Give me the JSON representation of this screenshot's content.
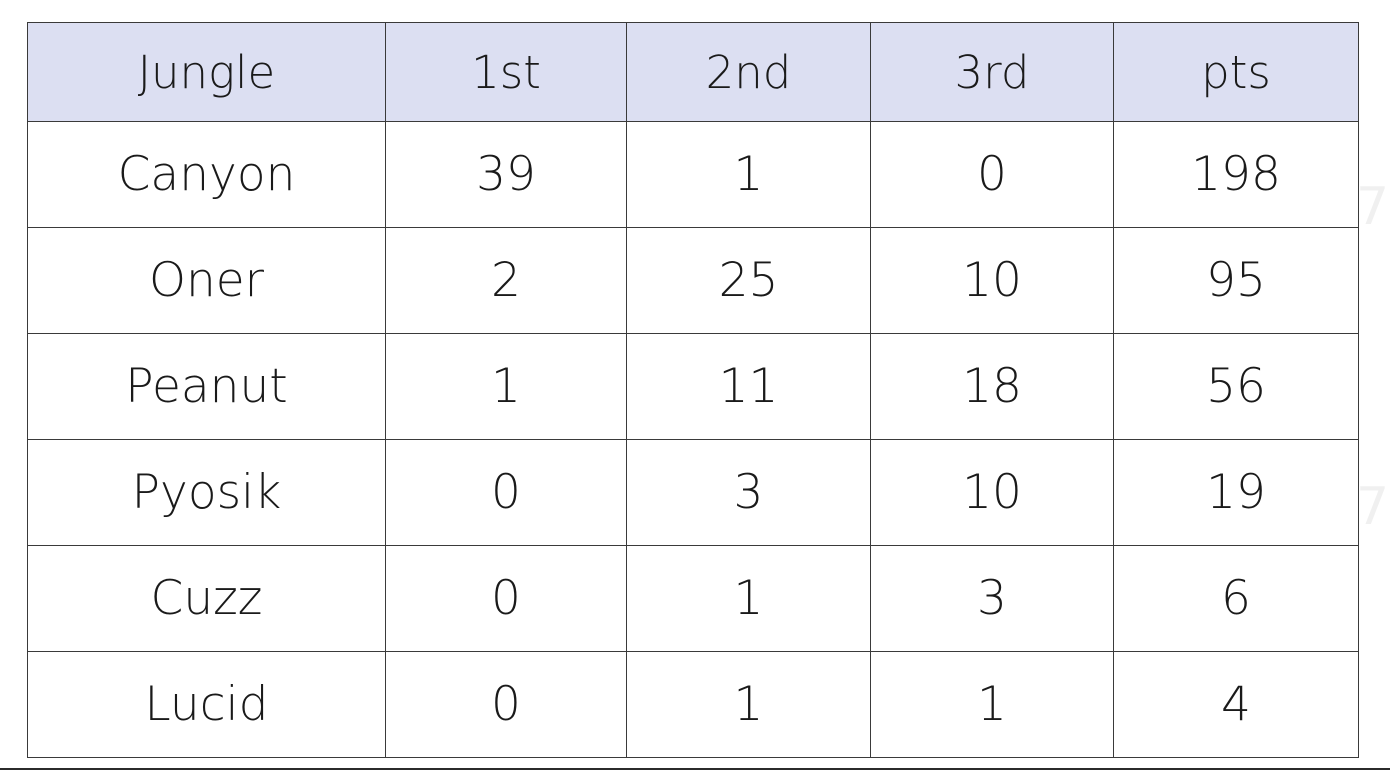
{
  "table": {
    "name": "jungle-standings",
    "columns": [
      "Jungle",
      "1st",
      "2nd",
      "3rd",
      "pts"
    ],
    "header_background": "#dcdff2",
    "border_color": "#3a3a3a",
    "text_color": "#1a1a1a",
    "rows": [
      {
        "player": "Canyon",
        "first": "39",
        "second": "1",
        "third": "0",
        "pts": "198"
      },
      {
        "player": "Oner",
        "first": "2",
        "second": "25",
        "third": "10",
        "pts": "95"
      },
      {
        "player": "Peanut",
        "first": "1",
        "second": "11",
        "third": "18",
        "pts": "56"
      },
      {
        "player": "Pyosik",
        "first": "0",
        "second": "3",
        "third": "10",
        "pts": "19"
      },
      {
        "player": "Cuzz",
        "first": "0",
        "second": "1",
        "third": "3",
        "pts": "6"
      },
      {
        "player": "Lucid",
        "first": "0",
        "second": "1",
        "third": "1",
        "pts": "4"
      }
    ]
  },
  "watermarks": {
    "color": "#f0f0f0",
    "top": "7",
    "bottom": "7"
  },
  "chart_data": {
    "type": "table",
    "title": "",
    "categories": [
      "Canyon",
      "Oner",
      "Peanut",
      "Pyosik",
      "Cuzz",
      "Lucid"
    ],
    "columns": [
      "Jungle",
      "1st",
      "2nd",
      "3rd",
      "pts"
    ],
    "series": [
      {
        "name": "1st",
        "values": [
          39,
          2,
          1,
          0,
          0,
          0
        ]
      },
      {
        "name": "2nd",
        "values": [
          1,
          25,
          11,
          3,
          1,
          1
        ]
      },
      {
        "name": "3rd",
        "values": [
          0,
          10,
          18,
          10,
          3,
          1
        ]
      },
      {
        "name": "pts",
        "values": [
          198,
          95,
          56,
          19,
          6,
          4
        ]
      }
    ],
    "xlabel": "Jungle",
    "ylabel": "",
    "grid": true,
    "legend": "none"
  }
}
